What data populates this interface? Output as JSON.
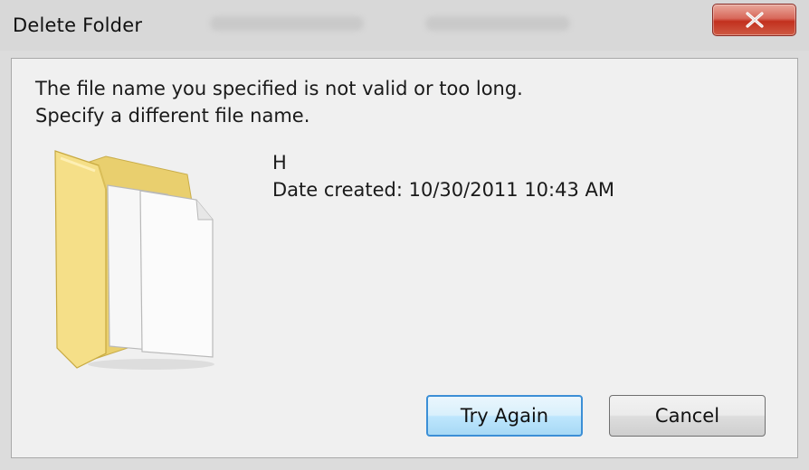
{
  "window": {
    "title": "Delete Folder",
    "close_icon": "close-x-icon",
    "close_color": "#c7382a"
  },
  "message": {
    "line1": "The file name you specified is not valid or too long.",
    "line2": "Specify a different file name."
  },
  "item": {
    "icon": "folder-icon",
    "name": "H",
    "date_created": "Date created: 10/30/2011 10:43 AM"
  },
  "buttons": {
    "primary_label": "Try Again",
    "secondary_label": "Cancel"
  },
  "colors": {
    "primary_border": "#3c8fd6",
    "folder_yellow": "#f3dd86"
  }
}
